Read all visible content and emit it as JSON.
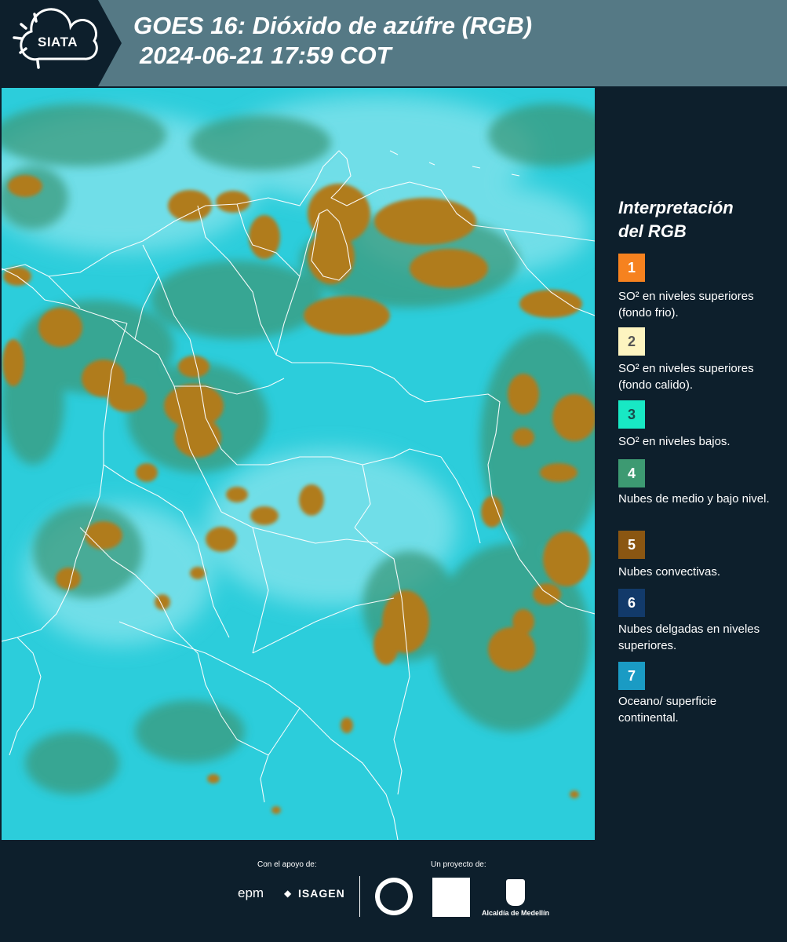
{
  "header": {
    "logo_text": "SIATA",
    "title_line1": "GOES 16: Dióxido de azúfre (RGB)",
    "title_line2": "2024-06-21 17:59 COT"
  },
  "legend": {
    "title_line1": "Interpretación",
    "title_line2": "del RGB",
    "items": [
      {
        "number": "1",
        "color": "#f6821f",
        "text_color": "#ffffff",
        "label": "SO² en niveles superiores (fondo frio)."
      },
      {
        "number": "2",
        "color": "#fdf4c0",
        "text_color": "#555555",
        "label": "SO² en niveles superiores (fondo calido)."
      },
      {
        "number": "3",
        "color": "#18e8c4",
        "text_color": "#1a4b4b",
        "label": "SO² en niveles bajos."
      },
      {
        "number": "4",
        "color": "#3d9a72",
        "text_color": "#ffffff",
        "label": "Nubes de medio y bajo nivel."
      },
      {
        "number": "5",
        "color": "#8a5612",
        "text_color": "#ffffff",
        "label": "Nubes convectivas."
      },
      {
        "number": "6",
        "color": "#123a6a",
        "text_color": "#ffffff",
        "label": "Nubes delgadas en niveles superiores."
      },
      {
        "number": "7",
        "color": "#1a9bc4",
        "text_color": "#ffffff",
        "label": "Oceano/ superficie continental."
      }
    ]
  },
  "footer": {
    "support_caption": "Con el apoyo de:",
    "project_caption": "Un proyecto de:",
    "sponsor_1": "epm",
    "sponsor_2": "ISAGEN",
    "partner_3": "Alcaldía de Medellín"
  },
  "map": {
    "background_color": "#25c8d8",
    "cloud_color": "#b07c1e",
    "border_color": "#ffffff"
  }
}
